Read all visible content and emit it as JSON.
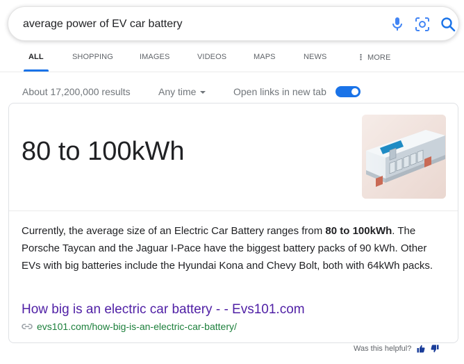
{
  "search": {
    "query": "average power of EV car battery",
    "icons": [
      "mic-icon",
      "lens-icon",
      "search-icon"
    ]
  },
  "tabs": [
    {
      "label": "ALL",
      "active": true
    },
    {
      "label": "SHOPPING",
      "active": false
    },
    {
      "label": "IMAGES",
      "active": false
    },
    {
      "label": "VIDEOS",
      "active": false
    },
    {
      "label": "MAPS",
      "active": false
    },
    {
      "label": "NEWS",
      "active": false
    },
    {
      "label": "MORE",
      "active": false
    }
  ],
  "tools": {
    "results_count": "About 17,200,000 results",
    "time_filter": "Any time",
    "new_tab_label": "Open links in new tab",
    "new_tab_enabled": true
  },
  "featured": {
    "answer": "80 to 100kWh",
    "snippet_before": "Currently, the average size of an Electric Car Battery ranges from ",
    "snippet_bold": "80 to 100kWh",
    "snippet_after": ". The Porsche Taycan and the Jaguar I-Pace have the biggest battery packs of 90 kWh. Other EVs with big batteries include the Hyundai Kona and Chevy Bolt, both with 64kWh packs.",
    "result_title": "How big is an electric car battery - - Evs101.com",
    "result_url": "evs101.com/how-big-is-an-electric-car-battery/"
  },
  "feedback": {
    "question": "Was this helpful?"
  },
  "colors": {
    "accent": "#1a73e8",
    "link_visited": "#4f1fa5",
    "url_green": "#1c7f3b"
  }
}
